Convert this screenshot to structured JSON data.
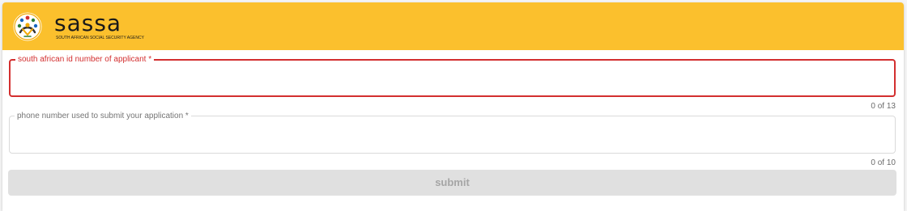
{
  "header": {
    "brand_name": "sassa",
    "brand_subtitle": "south african social security agency",
    "logo_icon": "sassa-logo-icon",
    "background_color": "#fbc02d"
  },
  "form": {
    "id_field": {
      "label": "south african id number of applicant *",
      "value": "",
      "counter": "0 of 13",
      "border_color": "#d32f2f"
    },
    "phone_field": {
      "label": "phone number used to submit your application *",
      "value": "",
      "counter": "0 of 10"
    },
    "submit_label": "submit"
  }
}
